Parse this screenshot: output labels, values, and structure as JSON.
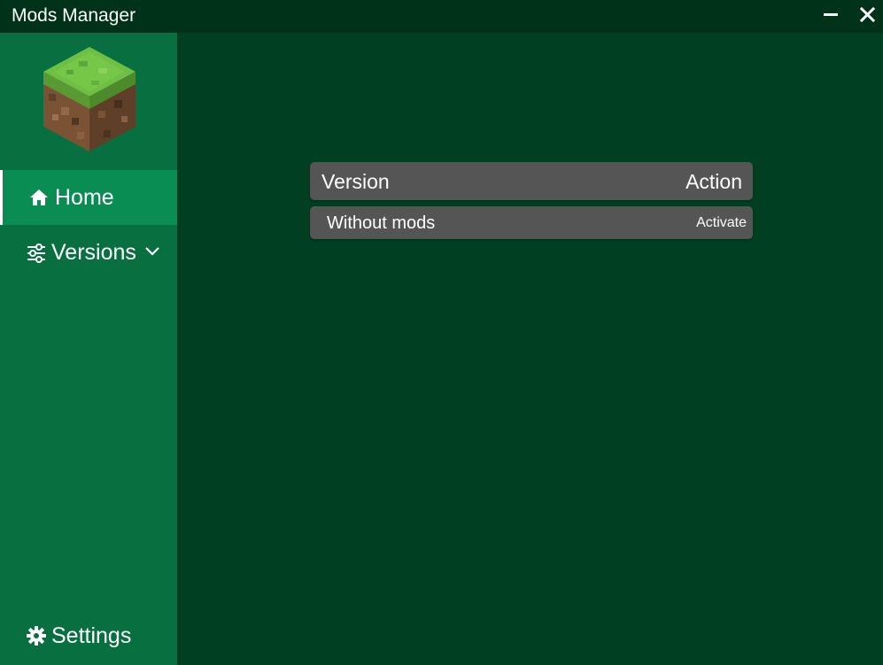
{
  "window": {
    "title": "Mods Manager"
  },
  "sidebar": {
    "logo_icon": "minecraft-grass-block-icon",
    "items": [
      {
        "label": "Home",
        "icon": "home-icon",
        "active": true
      },
      {
        "label": "Versions",
        "icon": "sliders-icon",
        "has_submenu": true
      },
      {
        "label": "Settings",
        "icon": "gear-icon"
      }
    ]
  },
  "table": {
    "headers": {
      "version": "Version",
      "action": "Action"
    },
    "rows": [
      {
        "version": "Without mods",
        "action": "Activate"
      }
    ]
  },
  "colors": {
    "titlebar": "#00321a",
    "sidebar": "#087040",
    "sidebar_active": "#0a8d52",
    "content_bg": "#003f22",
    "table_bg": "#555555"
  }
}
